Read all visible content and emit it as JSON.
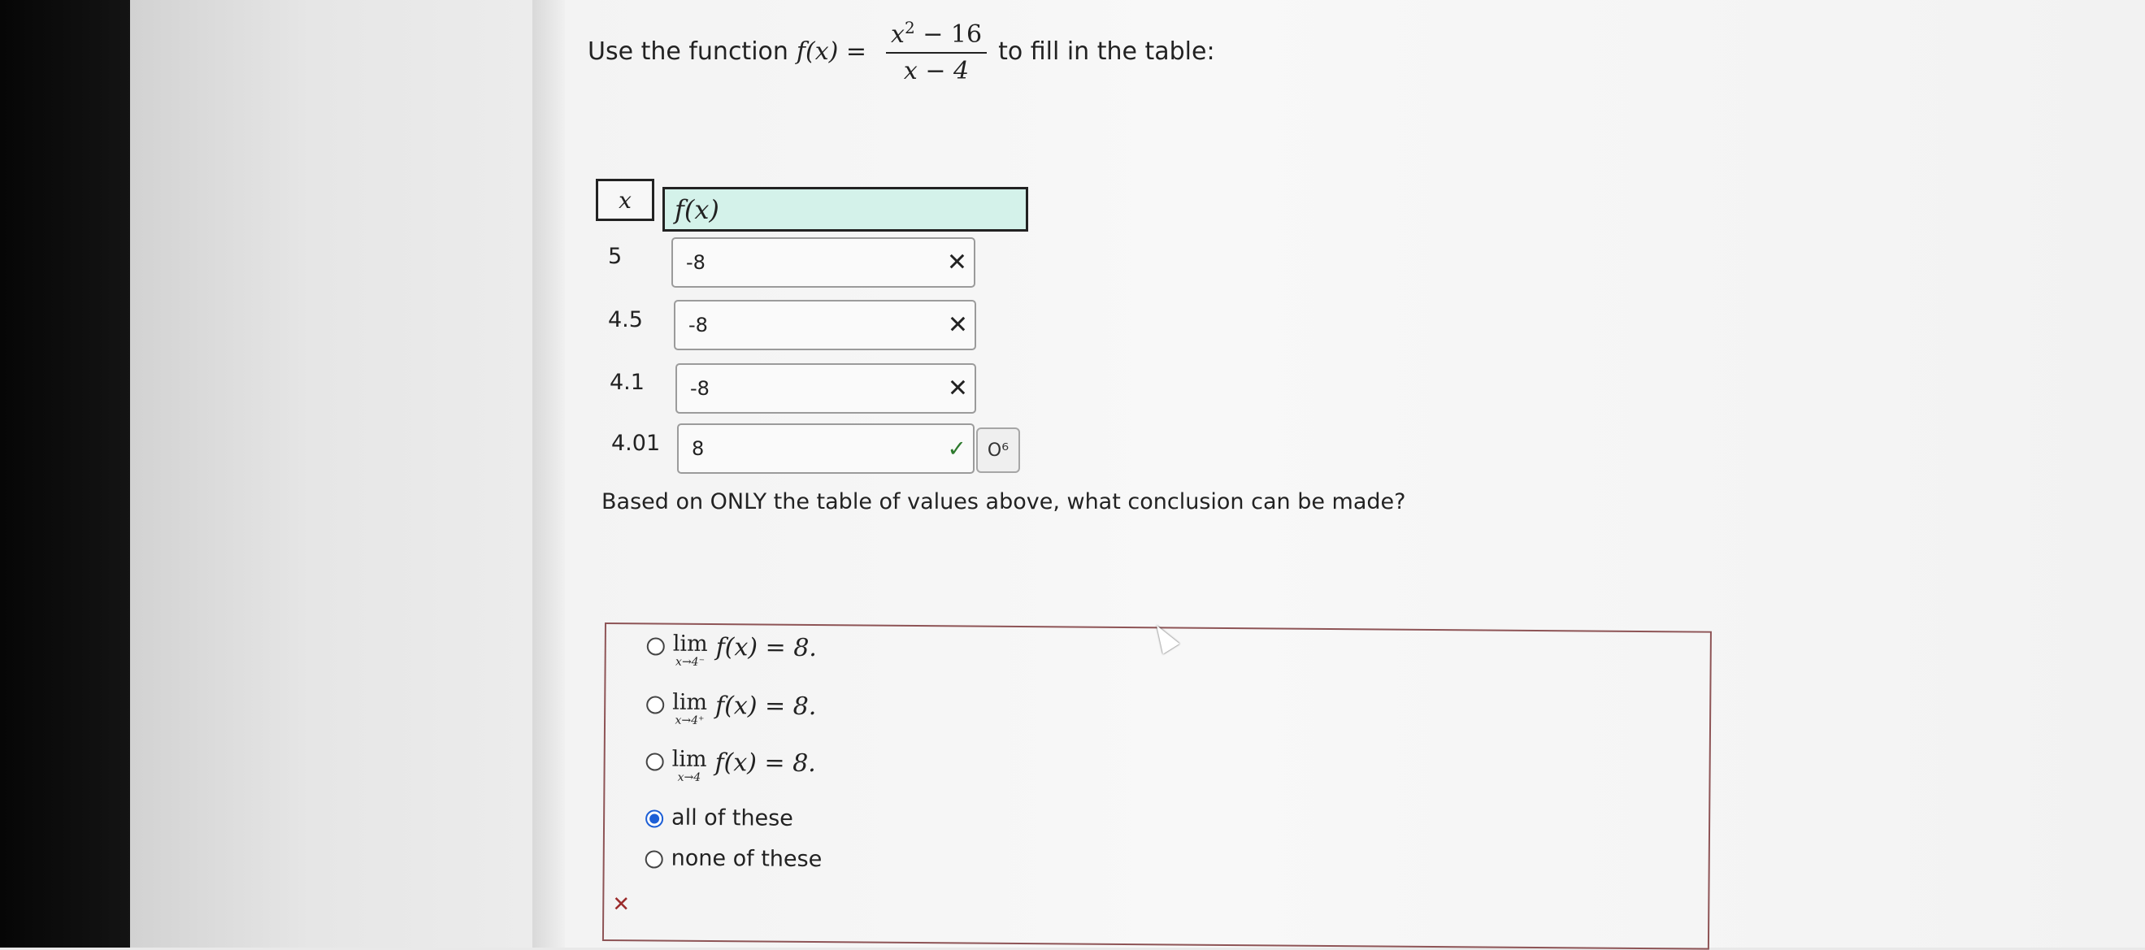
{
  "prompt": {
    "before": "Use the function",
    "func": "f(x) =",
    "num_base": "x",
    "num_exp": "2",
    "num_rest": " − 16",
    "den": "x − 4",
    "after": "to fill in the table:"
  },
  "table": {
    "header_x": "x",
    "header_f": "f(x)",
    "rows": [
      {
        "x": "5",
        "value": "-8",
        "status": "incorrect",
        "mark": "✕"
      },
      {
        "x": "4.5",
        "value": "-8",
        "status": "incorrect",
        "mark": "✕"
      },
      {
        "x": "4.1",
        "value": "-8",
        "status": "incorrect",
        "mark": "✕"
      },
      {
        "x": "4.01",
        "value": "8",
        "status": "correct",
        "mark": "✓"
      }
    ],
    "gear_label": "O⁶"
  },
  "question": "Based on ONLY the table of values above, what conclusion can be made?",
  "options": [
    {
      "lim": "lim",
      "sub": "x→4⁻",
      "expr": "f(x) = 8.",
      "selected": false
    },
    {
      "lim": "lim",
      "sub": "x→4⁺",
      "expr": "f(x) = 8.",
      "selected": false
    },
    {
      "lim": "lim",
      "sub": "x→4",
      "expr": "f(x) = 8.",
      "selected": false
    },
    {
      "text": "all of these",
      "selected": true
    },
    {
      "text": "none of these",
      "selected": false
    }
  ],
  "answer_status_mark": "✕",
  "colors": {
    "header_fill": "#d4f2ea",
    "selected_radio": "#1d5fd6",
    "answer_border": "#8e5456"
  }
}
